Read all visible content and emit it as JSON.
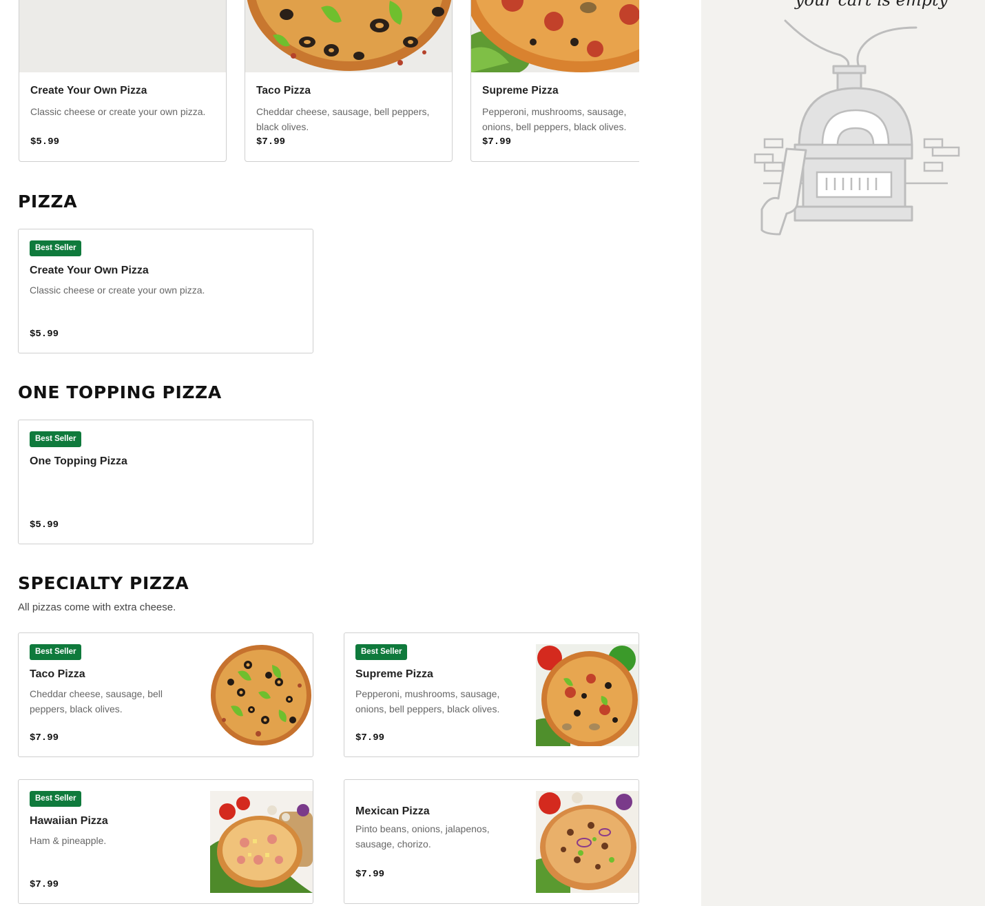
{
  "carousel": [
    {
      "name": "Create Your Own Pizza",
      "desc": "Classic cheese or create your own pizza.",
      "price": "$5.99"
    },
    {
      "name": "Taco Pizza",
      "desc": "Cheddar cheese, sausage, bell peppers, black olives.",
      "price": "$7.99"
    },
    {
      "name": "Supreme Pizza",
      "desc": "Pepperoni, mushrooms, sausage, onions, bell peppers, black olives.",
      "price": "$7.99"
    }
  ],
  "sections": {
    "pizza": {
      "title": "PIZZA",
      "items": [
        {
          "badge": "Best Seller",
          "name": "Create Your Own Pizza",
          "desc": "Classic cheese or create your own pizza.",
          "price": "$5.99"
        }
      ]
    },
    "one_topping": {
      "title": "ONE TOPPING PIZZA",
      "items": [
        {
          "badge": "Best Seller",
          "name": "One Topping Pizza",
          "desc": "",
          "price": "$5.99"
        }
      ]
    },
    "specialty": {
      "title": "SPECIALTY PIZZA",
      "subtitle": "All pizzas come with extra cheese.",
      "items": [
        {
          "badge": "Best Seller",
          "name": "Taco Pizza",
          "desc": "Cheddar cheese, sausage, bell peppers, black olives.",
          "price": "$7.99"
        },
        {
          "badge": "Best Seller",
          "name": "Supreme Pizza",
          "desc": "Pepperoni, mushrooms, sausage, onions, bell peppers, black olives.",
          "price": "$7.99"
        },
        {
          "badge": "Best Seller",
          "name": "Hawaiian Pizza",
          "desc": "Ham & pineapple.",
          "price": "$7.99"
        },
        {
          "badge": "",
          "name": "Mexican Pizza",
          "desc": "Pinto beans, onions, jalapenos, sausage, chorizo.",
          "price": "$7.99"
        }
      ]
    }
  },
  "cart": {
    "empty_text": "your cart is empty",
    "illustration": "pizza-oven-icon"
  },
  "colors": {
    "badge_bg": "#0f7a3c",
    "cart_bg": "#f3f2ef",
    "card_border": "#cfcfcf"
  }
}
